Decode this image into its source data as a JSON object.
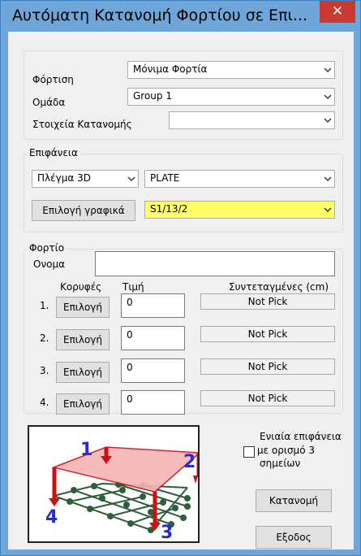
{
  "window": {
    "title": "Αυτόματη Κατανομή Φορτίου σε Επι...",
    "close_label": "✕"
  },
  "loading": {
    "label": "Φόρτιση",
    "value": "Μόνιμα Φορτία"
  },
  "group": {
    "label": "Ομάδα",
    "value": "Group 1"
  },
  "distribution_elements": {
    "label": "Στοιχεία Κατανομής",
    "value": ""
  },
  "surface": {
    "legend": "Επιφάνεια",
    "type_value": "Πλέγμα 3D",
    "element_value": "PLATE",
    "graphic_select_label": "Επιλογή γραφικά",
    "selection_value": "S1/13/2"
  },
  "load": {
    "legend": "Φορτίο",
    "name_label": "Ονομα",
    "name_value": "",
    "col_vertices": "Κορυφές",
    "col_value": "Τιμή",
    "col_coords": "Συντεταγμένες (cm)",
    "rows": [
      {
        "index": "1.",
        "select_label": "Επιλογή",
        "value": "0",
        "coords": "Not Pick"
      },
      {
        "index": "2.",
        "select_label": "Επιλογή",
        "value": "0",
        "coords": "Not Pick"
      },
      {
        "index": "3.",
        "select_label": "Επιλογή",
        "value": "0",
        "coords": "Not Pick"
      },
      {
        "index": "4.",
        "select_label": "Επιλογή",
        "value": "0",
        "coords": "Not Pick"
      }
    ]
  },
  "uniform_surface": {
    "label_line1": "Ενιαία επιφάνεια",
    "label_line2": "με ορισμό 3",
    "label_line3": "σημείων",
    "checked": false
  },
  "illustration": {
    "corner_labels": [
      "1",
      "2",
      "3",
      "4"
    ]
  },
  "actions": {
    "distribute_label": "Κατανομή",
    "exit_label": "Εξοδος"
  },
  "colors": {
    "title_bar": "#6fa6d9",
    "close_button": "#c73b31",
    "highlight_combo": "#ffff66",
    "plate_fill": "#f4b4b4",
    "load_arrow": "#cc1111",
    "corner_number": "#2a2ad8",
    "grid_node": "#2e5e3a"
  }
}
